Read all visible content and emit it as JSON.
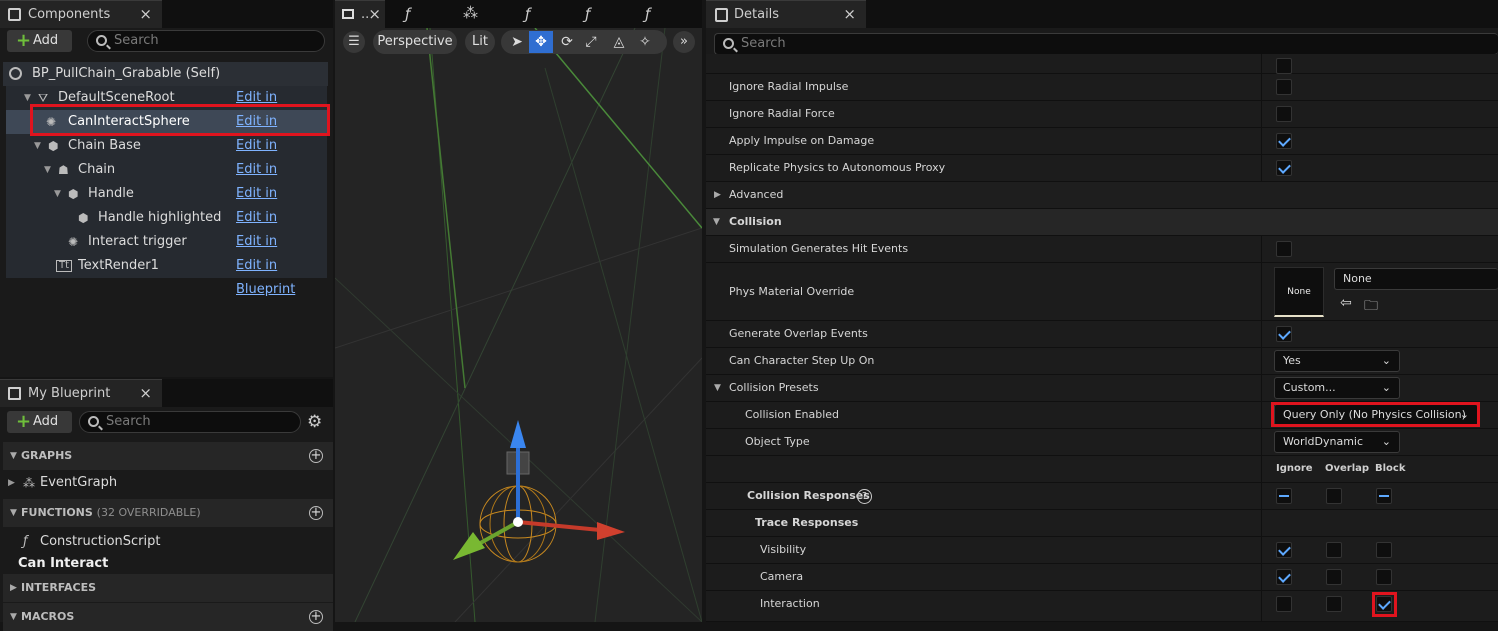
{
  "components": {
    "tab_title": "Components",
    "add_label": "Add",
    "search_placeholder": "Search",
    "self_label": "BP_PullChain_Grabable (Self)",
    "edit_label": "Edit in Blueprint",
    "items": [
      {
        "label": "DefaultSceneRoot",
        "icon": "scene-root-icon"
      },
      {
        "label": "CanInteractSphere",
        "icon": "sphere-collision-icon",
        "selected": true
      },
      {
        "label": "Chain Base",
        "icon": "static-mesh-icon"
      },
      {
        "label": "Chain",
        "icon": "skeletal-mesh-icon"
      },
      {
        "label": "Handle",
        "icon": "static-mesh-icon"
      },
      {
        "label": "Handle highlighted",
        "icon": "static-mesh-icon"
      },
      {
        "label": "Interact trigger",
        "icon": "sphere-collision-icon"
      },
      {
        "label": "TextRender1",
        "icon": "text-render-icon"
      }
    ]
  },
  "my_blueprint": {
    "tab_title": "My Blueprint",
    "add_label": "Add",
    "search_placeholder": "Search",
    "graphs_label": "GRAPHS",
    "event_graph": "EventGraph",
    "functions_label": "FUNCTIONS",
    "functions_sub": "(32 OVERRIDABLE)",
    "construction_script": "ConstructionScript",
    "can_interact": "Can Interact",
    "interfaces_label": "INTERFACES",
    "macros_label": "MACROS"
  },
  "viewport": {
    "tab_title": "..",
    "perspective": "Perspective",
    "lit": "Lit"
  },
  "details": {
    "tab_title": "Details",
    "search_placeholder": "Search",
    "rows": {
      "ignore_radial_impulse": "Ignore Radial Impulse",
      "ignore_radial_force": "Ignore Radial Force",
      "apply_impulse": "Apply Impulse on Damage",
      "replicate_physics": "Replicate Physics to Autonomous Proxy",
      "advanced": "Advanced",
      "collision": "Collision",
      "sim_hit_events": "Simulation Generates Hit Events",
      "phys_material": "Phys Material Override",
      "phys_material_thumb": "None",
      "phys_material_value": "None",
      "overlap_events": "Generate Overlap Events",
      "step_up": "Can Character Step Up On",
      "step_up_value": "Yes",
      "presets": "Collision Presets",
      "presets_value": "Custom...",
      "enabled": "Collision Enabled",
      "enabled_value": "Query Only (No Physics Collision)",
      "object_type": "Object Type",
      "object_type_value": "WorldDynamic",
      "col_ignore": "Ignore",
      "col_overlap": "Overlap",
      "col_block": "Block",
      "responses": "Collision Responses",
      "trace_responses": "Trace Responses",
      "visibility": "Visibility",
      "camera": "Camera",
      "interaction": "Interaction"
    }
  },
  "colors": {
    "accent": "#5ea9ff",
    "highlight": "#e0141e",
    "link": "#7fb3ff"
  }
}
